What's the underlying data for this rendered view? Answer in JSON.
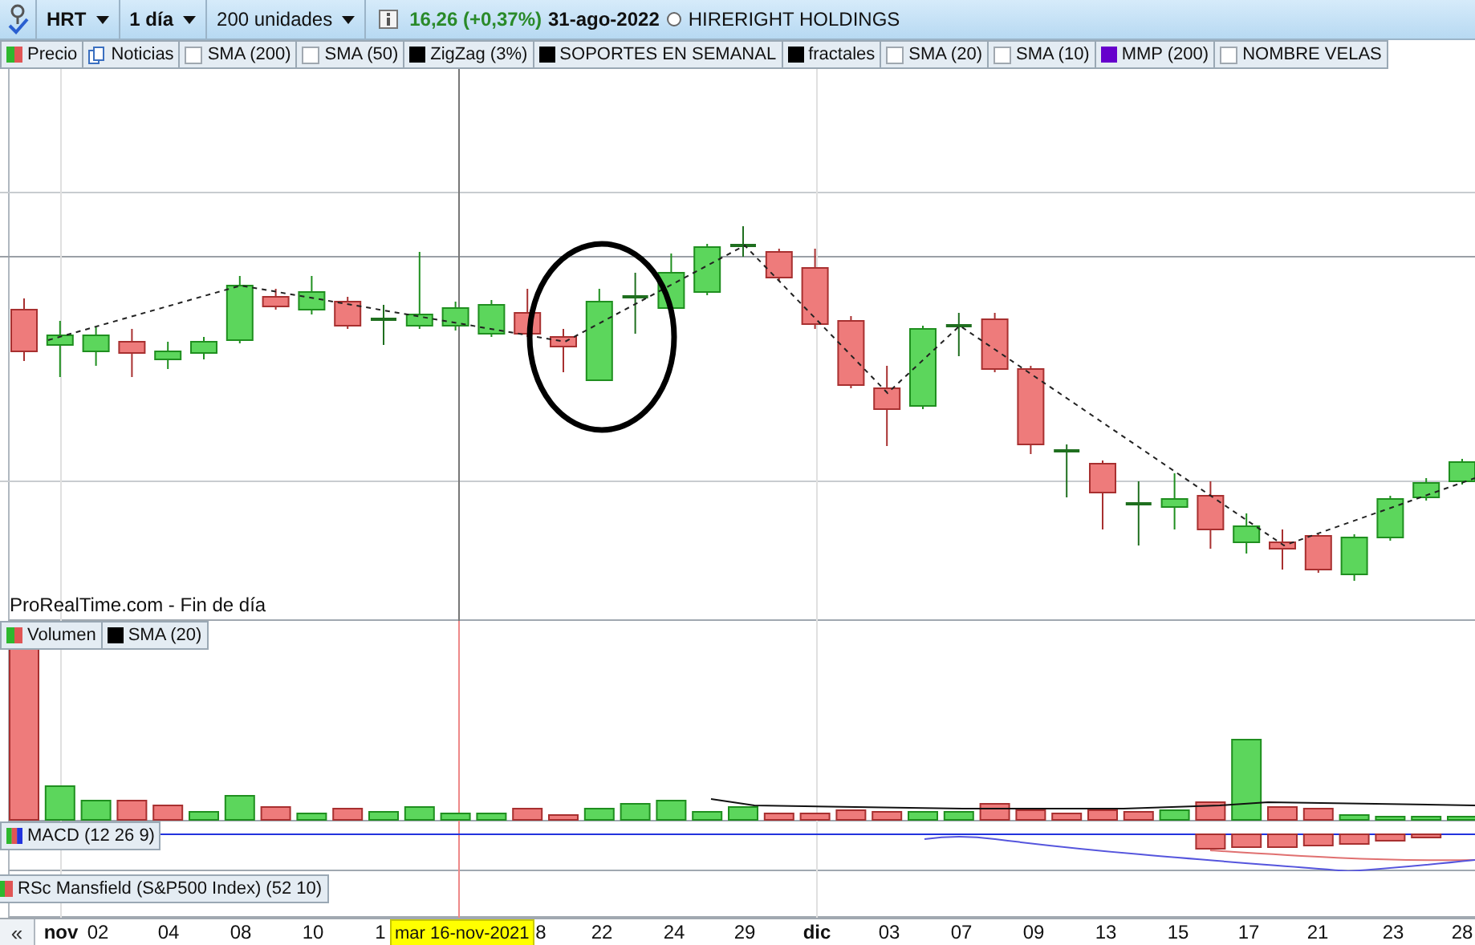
{
  "toolbar": {
    "symbol": "HRT",
    "period": "1 día",
    "units": "200 unidades",
    "price_change": "16,26 (+0,37%)",
    "date": "31-ago-2022",
    "company": "HIRERIGHT HOLDINGS"
  },
  "price_legend": [
    {
      "label": "Precio",
      "kind": "bicolor"
    },
    {
      "label": "Noticias",
      "kind": "news"
    },
    {
      "label": "SMA (200)",
      "kind": "box"
    },
    {
      "label": "SMA (50)",
      "kind": "box"
    },
    {
      "label": "ZigZag (3%)",
      "kind": "swatch",
      "color": "#000000"
    },
    {
      "label": "SOPORTES EN SEMANAL",
      "kind": "swatch",
      "color": "#000000"
    },
    {
      "label": "fractales",
      "kind": "swatch",
      "color": "#000000"
    },
    {
      "label": "SMA (20)",
      "kind": "box"
    },
    {
      "label": "SMA (10)",
      "kind": "box"
    },
    {
      "label": "MMP (200)",
      "kind": "swatch",
      "color": "#6600cc"
    },
    {
      "label": "NOMBRE VELAS",
      "kind": "box"
    }
  ],
  "source_label": "ProRealTime.com - Fin de día",
  "volume_legend": [
    {
      "label": "Volumen",
      "kind": "bicolor"
    },
    {
      "label": "SMA (20)",
      "kind": "swatch",
      "color": "#000000"
    }
  ],
  "macd_legend": [
    {
      "label": "MACD (12 26 9)",
      "kind": "tricolor"
    }
  ],
  "rsc_legend": [
    {
      "label": "RSc Mansfield (S&P500 Index) (52 10)",
      "kind": "bicolor"
    }
  ],
  "x_axis": {
    "scroll_button": "«",
    "labels": [
      {
        "text": "nov",
        "kind": "month"
      },
      {
        "text": "02",
        "kind": "day"
      },
      {
        "text": "04",
        "kind": "day"
      },
      {
        "text": "08",
        "kind": "day"
      },
      {
        "text": "10",
        "kind": "day"
      },
      {
        "text": "1",
        "kind": "day"
      },
      {
        "text": "8",
        "kind": "day"
      },
      {
        "text": "22",
        "kind": "day"
      },
      {
        "text": "24",
        "kind": "day"
      },
      {
        "text": "29",
        "kind": "day"
      },
      {
        "text": "dic",
        "kind": "month"
      },
      {
        "text": "03",
        "kind": "day"
      },
      {
        "text": "07",
        "kind": "day"
      },
      {
        "text": "09",
        "kind": "day"
      },
      {
        "text": "13",
        "kind": "day"
      },
      {
        "text": "15",
        "kind": "day"
      },
      {
        "text": "17",
        "kind": "day"
      },
      {
        "text": "21",
        "kind": "day"
      },
      {
        "text": "23",
        "kind": "day"
      },
      {
        "text": "28",
        "kind": "day"
      }
    ],
    "cursor_label": "mar 16-nov-2021"
  }
}
